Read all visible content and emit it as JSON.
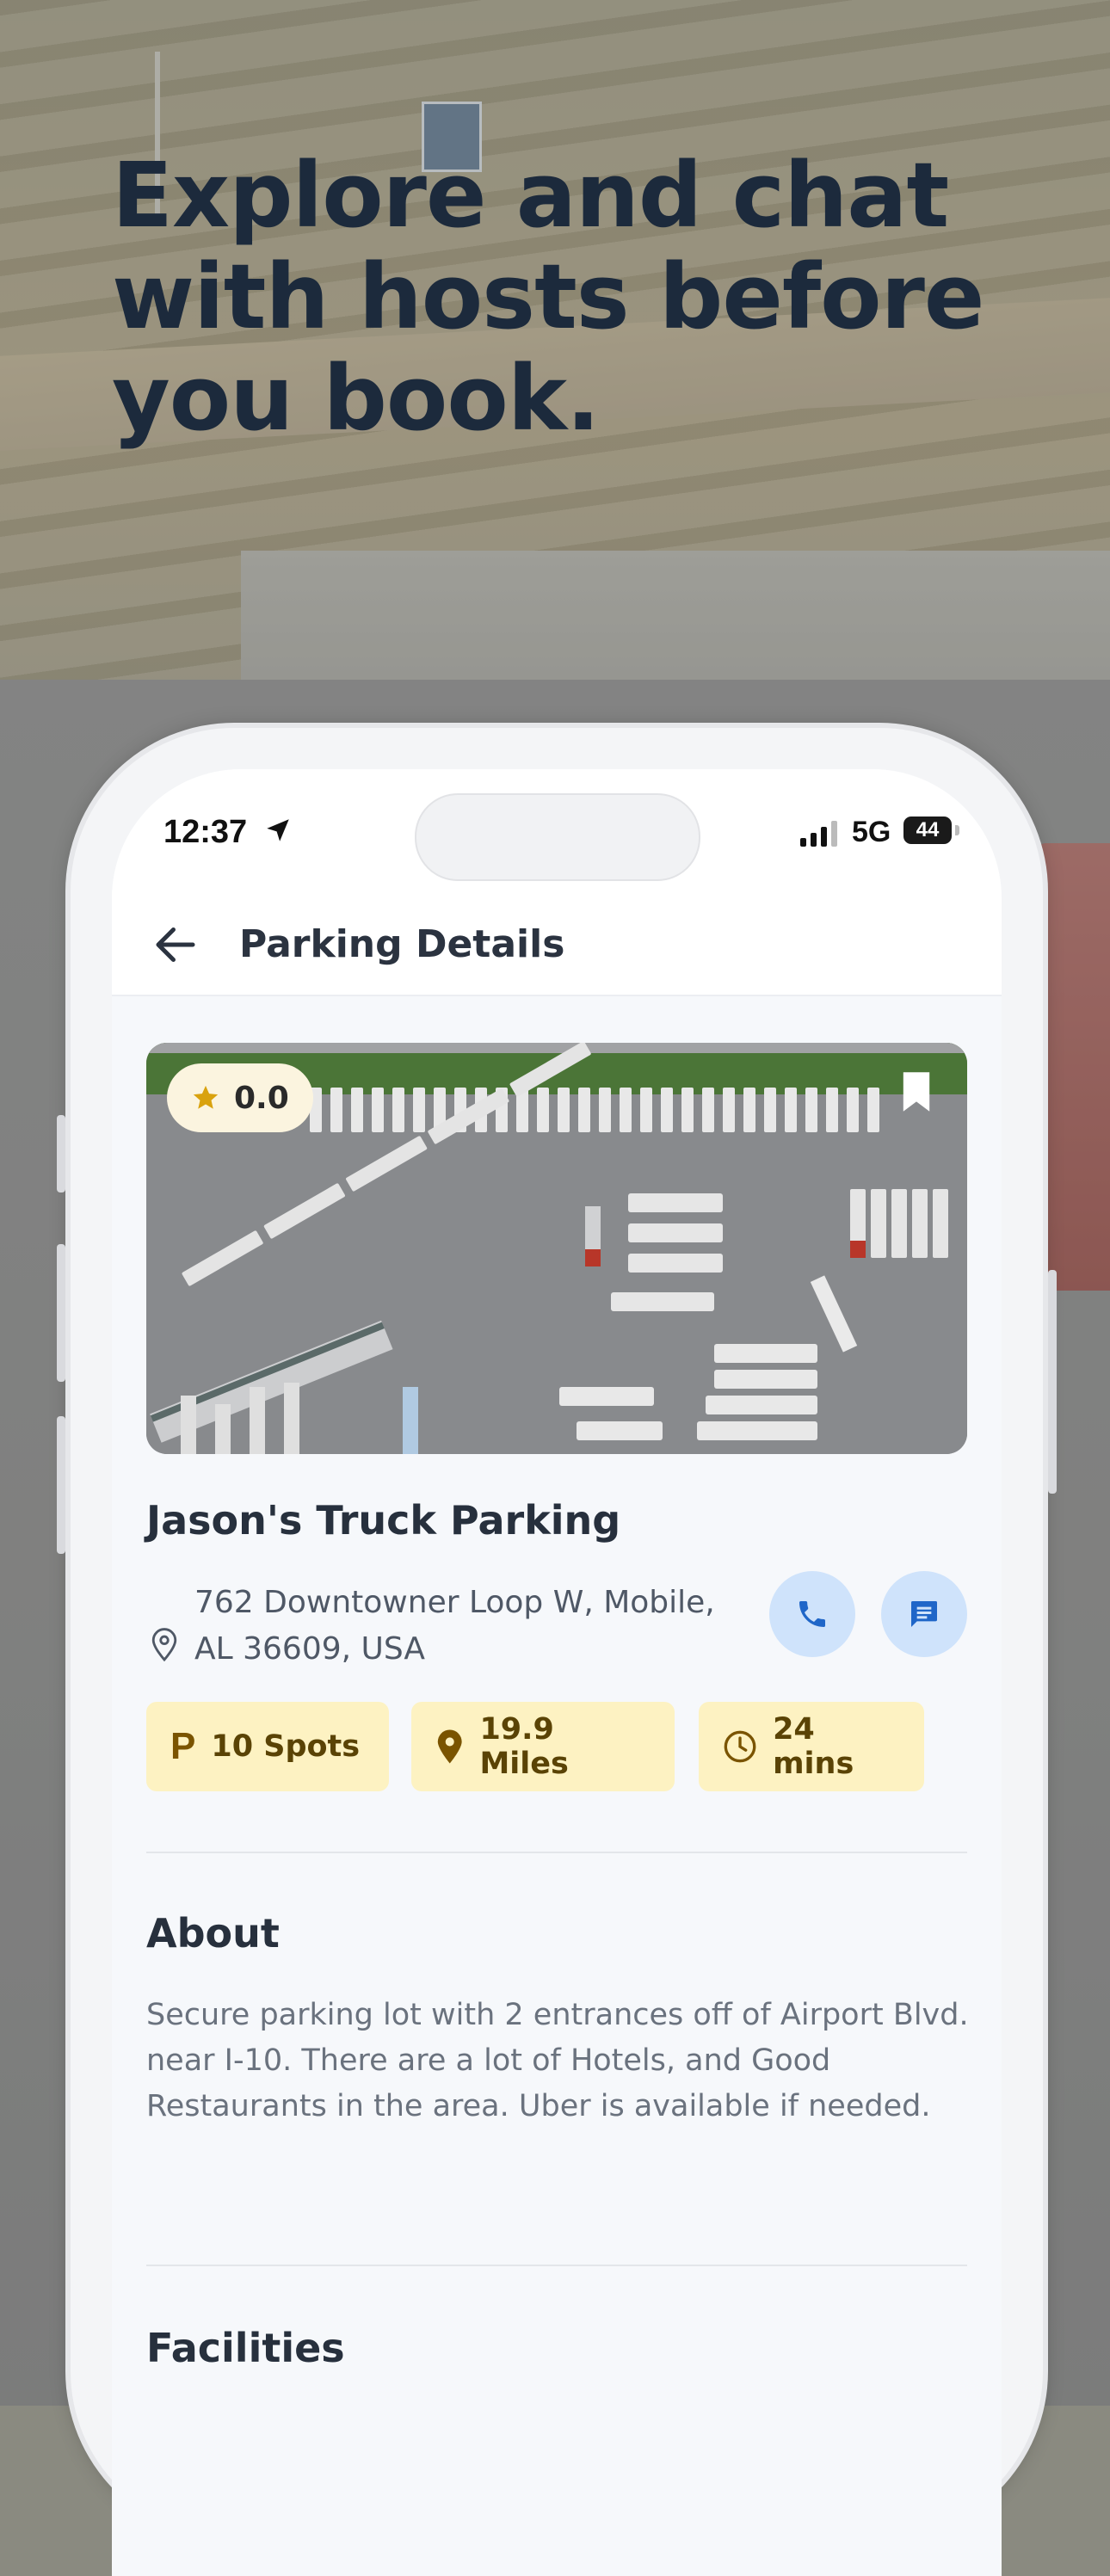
{
  "headline": "Explore and chat with hosts before you book.",
  "status_bar": {
    "time": "12:37",
    "network": "5G",
    "battery": "44"
  },
  "app_bar": {
    "title": "Parking Details",
    "back_icon": "arrow-left-icon"
  },
  "listing": {
    "rating": "0.0",
    "name": "Jason's Truck Parking",
    "address": "762 Downtowner Loop W, Mobile, AL 36609, USA",
    "chips": [
      {
        "icon": "parking-icon",
        "glyph": "P",
        "label": "10 Spots"
      },
      {
        "icon": "map-pin-icon",
        "label": "19.9 Miles"
      },
      {
        "icon": "clock-icon",
        "label": "24 mins"
      }
    ],
    "about": {
      "title": "About",
      "text": "Secure parking lot with 2 entrances off of Airport Blvd. near I-10. There are a lot of Hotels, and Good Restaurants in the area. Uber is available if needed."
    },
    "facilities": {
      "title": "Facilities"
    }
  },
  "colors": {
    "headline": "#1c2a3c",
    "chip_bg": "#fdf2c2",
    "action_bg": "#cfe3fb",
    "action_icon": "#1f66c8",
    "star": "#d9a20e"
  }
}
